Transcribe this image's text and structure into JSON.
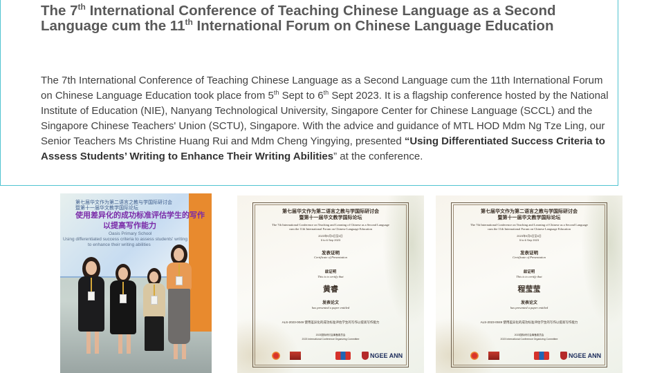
{
  "slide": {
    "title": {
      "p1": "The 7",
      "sup1": "th",
      "p2": " International Conference of Teaching Chinese Language as a Second Language cum the 11",
      "sup2": "th",
      "p3": "  International Forum on Chinese Language Education"
    },
    "body": {
      "t1": "The 7th International  Conference of Teaching Chinese Language as a Second Language cum the 11th International Forum on Chinese Language Education took place from 5",
      "sup1": "th",
      "t2": " Sept to 6",
      "sup2": "th",
      "t3": " Sept 2023. It is a flagship conference hosted by the National Institute  of Education (NIE), Nanyang Technological University, Singapore Center for Chinese Language (SCCL) and the Singapore Chinese Teachers' Union (SCTU), Singapore. With the advice and guidance of MTL HOD Mdm Ng Tze Ling, our Senior Teachers Ms Christine Huang Rui and Mdm Cheng Yingying, presented ",
      "bold": "“Using Differentiated Success Criteria to Assess Students’ Writing to Enhance Their Writing Abilities",
      "t4": "” at the conference."
    },
    "photo": {
      "banner_line1": "第七届华文作为第二语言之教与学国际研讨会",
      "banner_line2": "暨第十一届华文教学国际论坛",
      "banner_title1": "使用差异化的成功标准评估学生的写作",
      "banner_title2": "以提高写作能力",
      "banner_school": "Oasis Primary School",
      "banner_en1": "Using differentiated success criteria to assess students' writing",
      "banner_en2": "to enhance their writing abilities"
    },
    "certificates": [
      {
        "cn_title": "第七届华文作为第二语言之教与学国际研讨会",
        "cn_title2": "暨第十一届华文教学国际论坛",
        "en1": "The 7th International Conference on Teaching and Learning of Chinese as a Second Language",
        "en2": "cum the 11th International Forum on Chinese Language Education",
        "date_cn": "2023年9月5日至6日",
        "date_en": "5 to 6 Sep 2023",
        "cert_cn": "发表证明",
        "cert_en": "Certificate of Presentation",
        "certify_cn": "兹证明",
        "certify_en": "This is to certify that",
        "name": "黄睿",
        "paper_cn": "发表论文",
        "paper_en": "has presented a paper entitled",
        "paper_title": "ALS-2023-0049 使用差异化的成功标准评估学生的写作以提高写作能力",
        "org1": "2023国际研讨会筹备委员会",
        "org2": "2023 International Conference Organizing Committee",
        "logo_text": "NGEE ANN"
      },
      {
        "cn_title": "第七届华文作为第二语言之教与学国际研讨会",
        "cn_title2": "暨第十一届华文教学国际论坛",
        "en1": "The 7th International Conference on Teaching and Learning of Chinese as a Second Language",
        "en2": "cum the 11th International Forum on Chinese Language Education",
        "date_cn": "2023年9月5日至6日",
        "date_en": "5 to 6 Sep 2023",
        "cert_cn": "发表证明",
        "cert_en": "Certificate of Presentation",
        "certify_cn": "兹证明",
        "certify_en": "This is to certify that",
        "name": "程莹莹",
        "paper_cn": "发表论文",
        "paper_en": "has presented a paper entitled",
        "paper_title": "ALS-2023-0049 使用差异化的成功标准评估学生的写作以提高写作能力",
        "org1": "2023国际研讨会筹备委员会",
        "org2": "2023 International Conference Organizing Committee",
        "logo_text": "NGEE ANN"
      }
    ]
  }
}
